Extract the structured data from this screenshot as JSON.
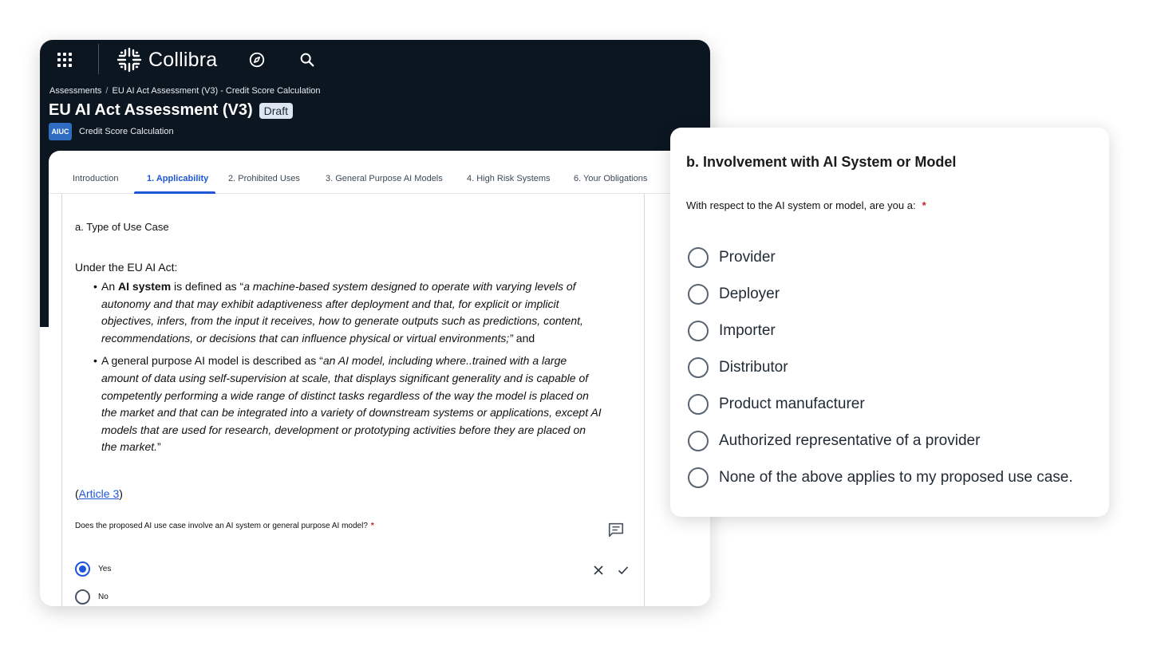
{
  "header": {
    "brand": "Collibra",
    "breadcrumb": [
      "Assessments",
      "EU AI Act Assessment (V3) - Credit Score Calculation"
    ],
    "title": "EU AI Act Assessment (V3)",
    "status_badge": "Draft",
    "asset_chip": "AIUC",
    "asset_name": "Credit Score Calculation"
  },
  "tabs": [
    {
      "label": "Introduction",
      "active": false
    },
    {
      "label": "1. Applicability",
      "active": true
    },
    {
      "label": "2. Prohibited Uses",
      "active": false
    },
    {
      "label": "3. General Purpose AI Models",
      "active": false
    },
    {
      "label": "4. High Risk Systems",
      "active": false
    },
    {
      "label": "6. Your Obligations",
      "active": false
    }
  ],
  "section": {
    "title": "a. Type of Use Case",
    "intro": "Under the EU AI Act:",
    "bullet1": {
      "pre": "An ",
      "bold": "AI system",
      "mid": " is defined as “",
      "italic": "a machine-based system designed to operate with varying levels of autonomy and that may exhibit adaptiveness after deployment and that, for explicit or implicit objectives, infers, from the input it receives, how to generate outputs such as predictions, content, recommendations, or decisions that can influence physical or virtual environments;”",
      "post": " and"
    },
    "bullet2": {
      "pre": " A general purpose AI model is described as “",
      "italic": "an AI model, including where..trained with a large amount of data using self-supervision at scale, that displays significant generality and is capable of competently performing a wide range of distinct tasks regardless of the way the model is placed on the market and that can be integrated into a variety of downstream systems or applications, except AI models that are used for research, development or prototyping activities before they are placed on the market.",
      "post": "”"
    },
    "article_open": "(",
    "article_link": "Article 3",
    "article_close": ")",
    "question": "Does the proposed AI use case involve an AI system or general purpose AI model?",
    "required_mark": "*",
    "options": [
      {
        "label": "Yes",
        "selected": true
      },
      {
        "label": "No",
        "selected": false
      }
    ]
  },
  "panel": {
    "title": "b. Involvement with AI System or Model",
    "question": "With respect to the AI system or model, are you a:",
    "required_mark": "*",
    "options": [
      {
        "label": "Provider"
      },
      {
        "label": "Deployer"
      },
      {
        "label": "Importer"
      },
      {
        "label": "Distributor"
      },
      {
        "label": "Product manufacturer"
      },
      {
        "label": "Authorized representative of a provider"
      },
      {
        "label": "None of the above applies to my proposed use case."
      }
    ]
  },
  "icons": {
    "apps": "apps-grid-icon",
    "logo": "collibra-logo-icon",
    "explore": "compass-icon",
    "search": "search-icon",
    "comment": "comment-icon",
    "cancel": "close-icon",
    "confirm": "check-icon"
  },
  "colors": {
    "header_bg": "#0c1621",
    "accent": "#1f56d8",
    "asset_chip": "#2d6cc0",
    "required": "#c0202a"
  }
}
